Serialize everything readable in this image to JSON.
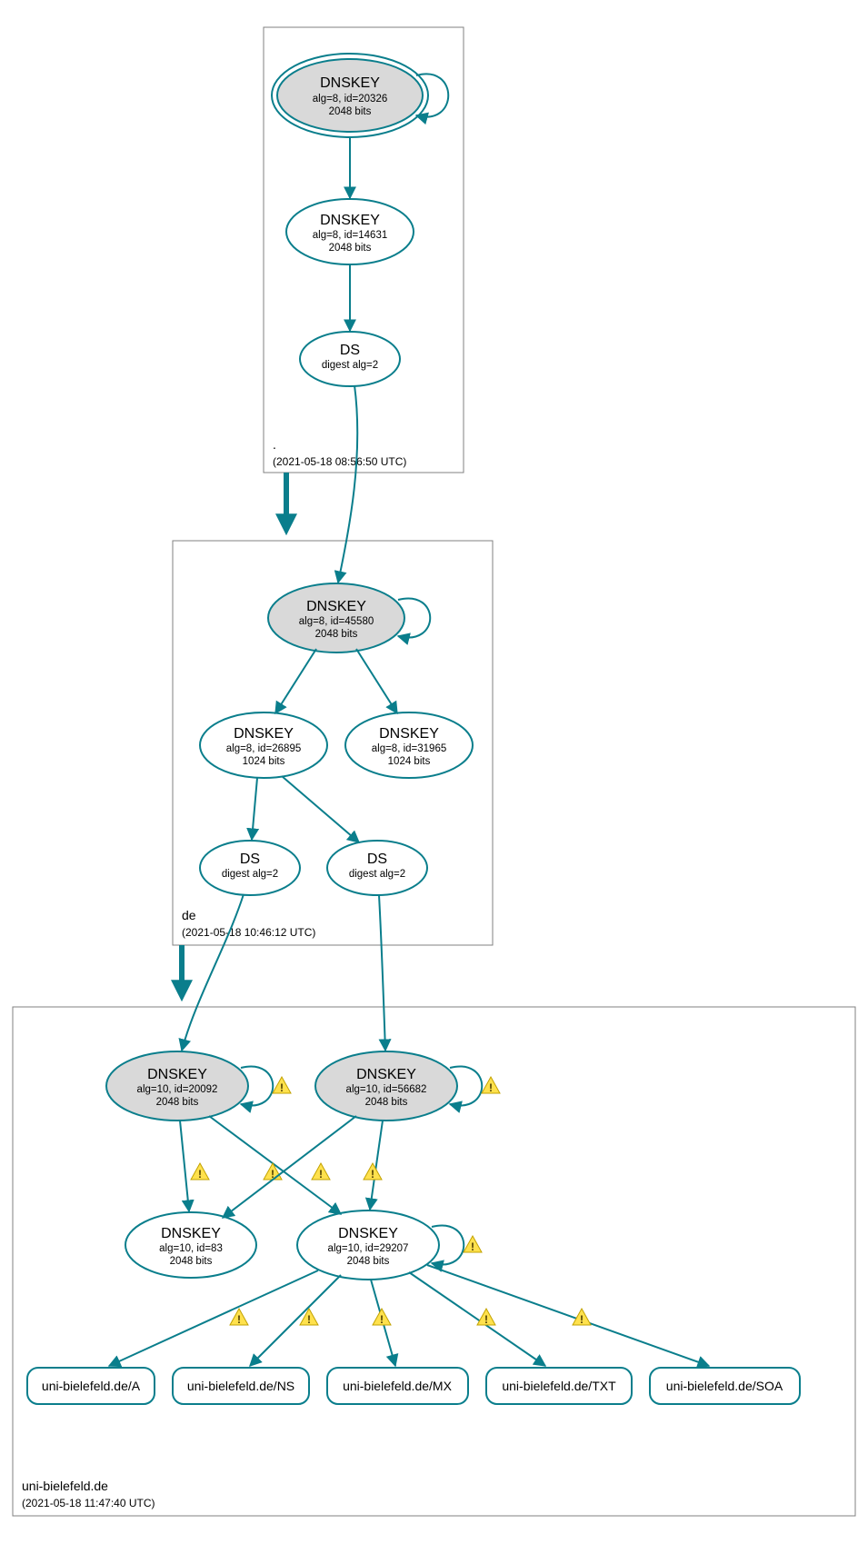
{
  "colors": {
    "line": "#0a7e8c",
    "ksk_fill": "#d9d9d9"
  },
  "zones": {
    "root": {
      "name": ".",
      "ts": "(2021-05-18 08:56:50 UTC)",
      "nodes": {
        "ksk": {
          "title": "DNSKEY",
          "l2": "alg=8, id=20326",
          "l3": "2048 bits"
        },
        "zsk": {
          "title": "DNSKEY",
          "l2": "alg=8, id=14631",
          "l3": "2048 bits"
        },
        "ds": {
          "title": "DS",
          "l2": "digest alg=2"
        }
      }
    },
    "de": {
      "name": "de",
      "ts": "(2021-05-18 10:46:12 UTC)",
      "nodes": {
        "ksk": {
          "title": "DNSKEY",
          "l2": "alg=8, id=45580",
          "l3": "2048 bits"
        },
        "zsk1": {
          "title": "DNSKEY",
          "l2": "alg=8, id=26895",
          "l3": "1024 bits"
        },
        "zsk2": {
          "title": "DNSKEY",
          "l2": "alg=8, id=31965",
          "l3": "1024 bits"
        },
        "ds1": {
          "title": "DS",
          "l2": "digest alg=2"
        },
        "ds2": {
          "title": "DS",
          "l2": "digest alg=2"
        }
      }
    },
    "ub": {
      "name": "uni-bielefeld.de",
      "ts": "(2021-05-18 11:47:40 UTC)",
      "nodes": {
        "ksk1": {
          "title": "DNSKEY",
          "l2": "alg=10, id=20092",
          "l3": "2048 bits"
        },
        "ksk2": {
          "title": "DNSKEY",
          "l2": "alg=10, id=56682",
          "l3": "2048 bits"
        },
        "zsk1": {
          "title": "DNSKEY",
          "l2": "alg=10, id=83",
          "l3": "2048 bits"
        },
        "zsk2": {
          "title": "DNSKEY",
          "l2": "alg=10, id=29207",
          "l3": "2048 bits"
        }
      },
      "rr": {
        "a": "uni-bielefeld.de/A",
        "ns": "uni-bielefeld.de/NS",
        "mx": "uni-bielefeld.de/MX",
        "txt": "uni-bielefeld.de/TXT",
        "soa": "uni-bielefeld.de/SOA"
      }
    }
  }
}
